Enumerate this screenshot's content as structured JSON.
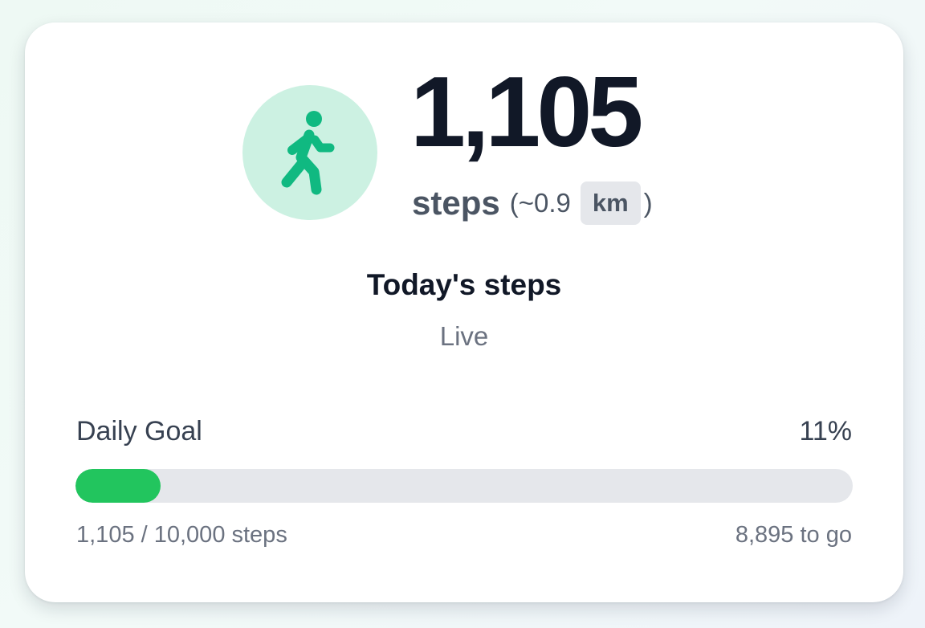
{
  "widget": {
    "icon": "walking-person-icon",
    "step_count": "1,105",
    "steps_label": "steps",
    "paren_open": "(~",
    "distance_value": "0.9",
    "distance_unit": "km",
    "paren_close": ")",
    "title": "Today's steps",
    "status": "Live"
  },
  "goal": {
    "label": "Daily Goal",
    "percent_label": "11%",
    "progress_fraction": 0.11,
    "progress_text": "1,105 / 10,000 steps",
    "remaining_text": "8,895 to go"
  },
  "colors": {
    "accent": "#10b981",
    "icon_background": "#ccf1e2",
    "progress_fill": "#22c55e",
    "progress_track": "#e5e7eb",
    "primary_text": "#111827",
    "secondary_text": "#6b7280"
  }
}
